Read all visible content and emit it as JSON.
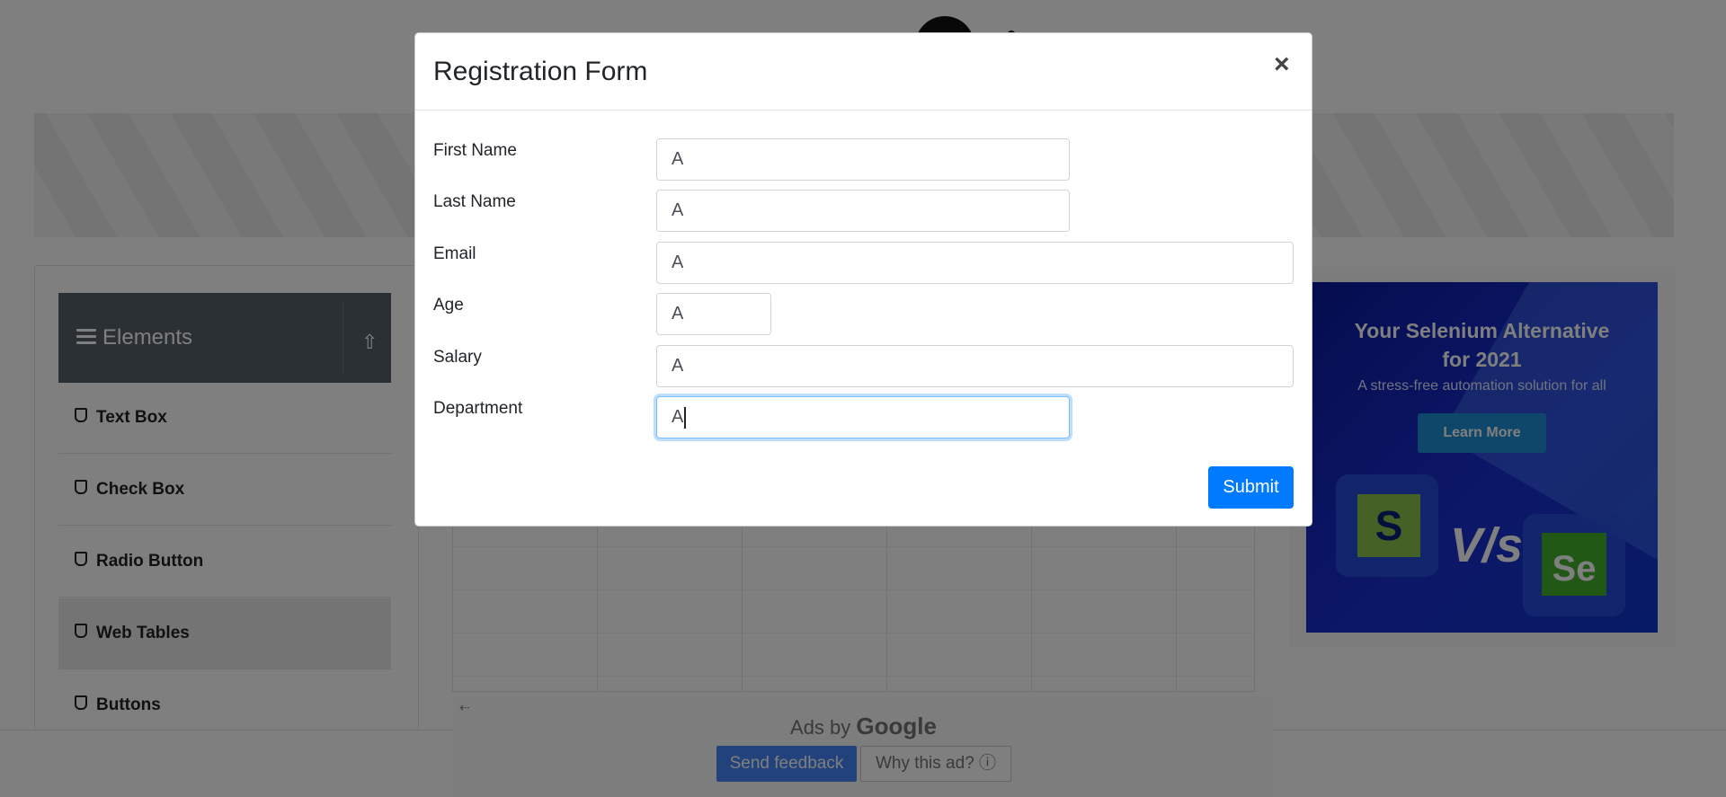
{
  "sidebar": {
    "header_title": "Elements",
    "items": [
      {
        "label": "Text Box"
      },
      {
        "label": "Check Box"
      },
      {
        "label": "Radio Button"
      },
      {
        "label": "Web Tables"
      },
      {
        "label": "Buttons"
      }
    ],
    "active_item": "Web Tables"
  },
  "ad": {
    "title_line1": "Your Selenium Alternative",
    "title_line2": "for 2021",
    "subtitle": "A stress-free automation solution for all",
    "button_label": "Learn More",
    "vs_text": "V/s",
    "left_logo": "S",
    "right_logo": "Se"
  },
  "ads_by": {
    "prefix": "Ads by",
    "brand": "Google",
    "feedback_label": "Send feedback",
    "why_label": "Why this ad? ⓘ"
  },
  "modal": {
    "title": "Registration Form",
    "close_symbol": "×",
    "fields": [
      {
        "label": "First Name",
        "value": "A"
      },
      {
        "label": "Last Name",
        "value": "A"
      },
      {
        "label": "Email",
        "value": "A"
      },
      {
        "label": "Age",
        "value": "A"
      },
      {
        "label": "Salary",
        "value": "A"
      },
      {
        "label": "Department",
        "value": "A"
      }
    ],
    "focused_field": "Department",
    "submit_label": "Submit"
  },
  "colors": {
    "primary": "#007bff",
    "sidebar_header": "#56606a",
    "ad_blue": "#1a2ed0",
    "backdrop": "rgba(0,0,0,0.5)"
  }
}
